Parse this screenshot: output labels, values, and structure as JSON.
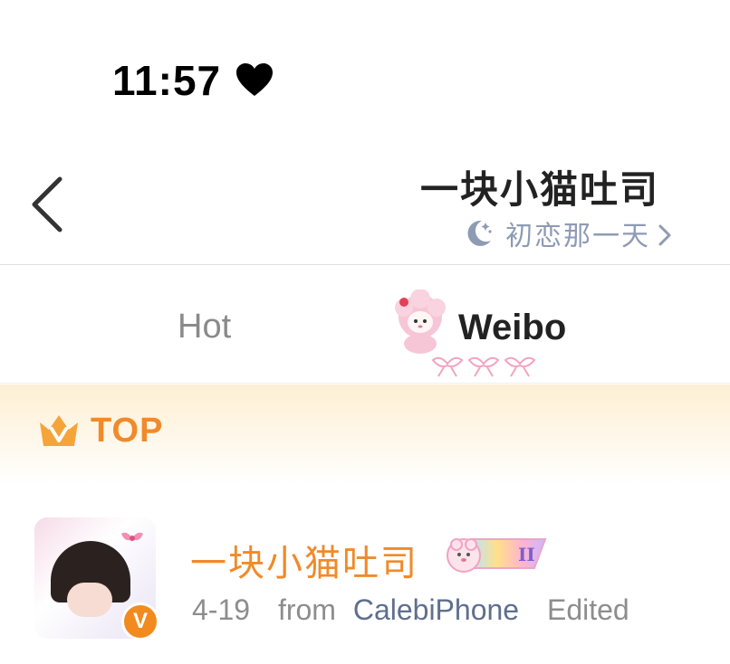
{
  "status_bar": {
    "time": "11:57",
    "icon": "heart-icon"
  },
  "header": {
    "back_icon": "chevron-left-icon",
    "profile_name": "一块小猫吐司",
    "status_icon": "moon-stars-icon",
    "status_text": "初恋那一天",
    "status_chevron": "chevron-right-icon"
  },
  "tabs": [
    {
      "label": "Hot",
      "active": false
    },
    {
      "label": "Weibo",
      "active": true
    }
  ],
  "pinned": {
    "label": "TOP",
    "icon": "crown-icon",
    "color": "#f08a2a"
  },
  "post": {
    "author": "一块小猫吐司",
    "verified_icon": "verified-v-icon",
    "badge_text": "II",
    "date": "4-19",
    "from_label": "from",
    "source": "CalebiPhone",
    "edited_label": "Edited"
  },
  "colors": {
    "accent": "#f08a2a",
    "source_link": "#5f6f8f",
    "muted": "#8d8d8d"
  }
}
